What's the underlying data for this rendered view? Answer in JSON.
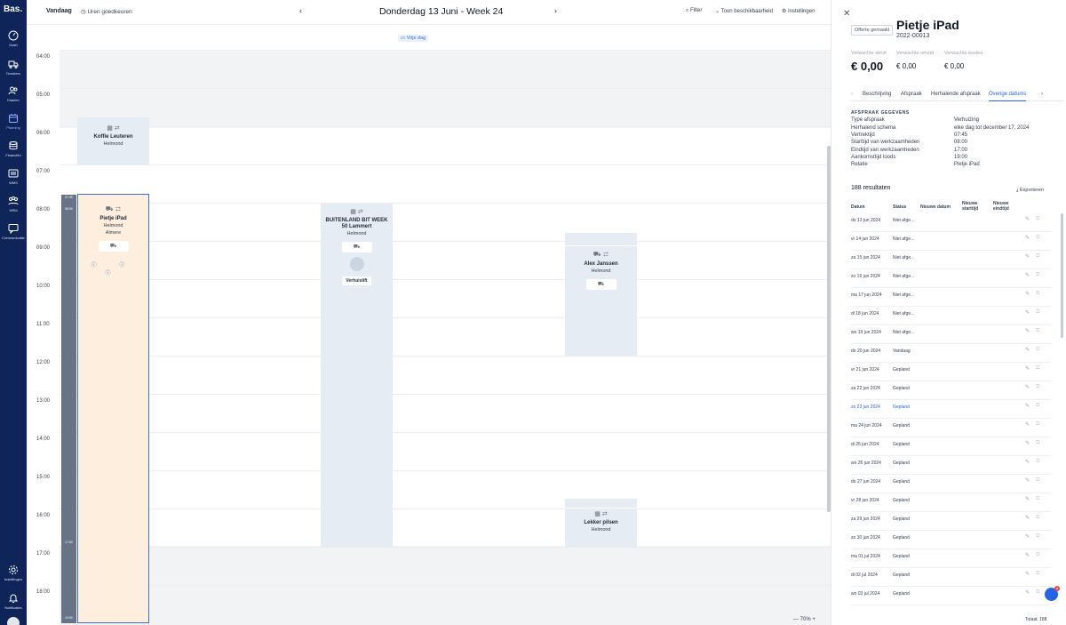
{
  "sidebar": {
    "logo": "Bas.",
    "items": [
      {
        "label": "Dash",
        "icon": "gauge-icon"
      },
      {
        "label": "Dossiers",
        "icon": "truck-icon"
      },
      {
        "label": "Klanten",
        "icon": "users-icon"
      },
      {
        "label": "Planning",
        "icon": "calendar-icon",
        "active": true
      },
      {
        "label": "Financiën",
        "icon": "coins-icon"
      },
      {
        "label": "WMS",
        "icon": "warehouse-icon"
      },
      {
        "label": "HRM",
        "icon": "people-icon"
      },
      {
        "label": "Communicatie",
        "icon": "chat-icon"
      },
      {
        "label": "Instellingen",
        "icon": "gear-icon"
      },
      {
        "label": "Notificaties",
        "icon": "bell-icon"
      }
    ]
  },
  "topbar": {
    "today": "Vandaag",
    "approve_hours": "Uren goedkeuren",
    "prev": "‹",
    "date_title": "Donderdag 13 Juni - Week 24",
    "next": "›",
    "filter": "Filter",
    "show_availability": "Toon beschikbaarheid",
    "settings": "Instellingen"
  },
  "calendar": {
    "free_day": "Vrije dag",
    "hours": [
      "04:00",
      "05:00",
      "06:00",
      "07:00",
      "08:00",
      "09:00",
      "10:00",
      "11:00",
      "12:00",
      "13:00",
      "14:00",
      "15:00",
      "16:00",
      "17:00",
      "18:00"
    ],
    "timeline_labels": {
      "start": "07:45",
      "start2": "08:00",
      "end": "17:00",
      "end2": "19:00"
    },
    "zoom": "— 70% +",
    "events": {
      "koffie": {
        "title": "Koffie Leuteren",
        "line1": "Helmond"
      },
      "pietje": {
        "title": "Pietje iPad",
        "line1": "Helmond",
        "line2": "Almere",
        "icons": "ⓘ ⓘ ⓘ"
      },
      "buitenland": {
        "title": "BUITENLAND BIT WEEK",
        "line1": "50 Lammert",
        "line2": "Helmond",
        "button": "Verhuislift"
      },
      "alex": {
        "title": "Alex Janssen",
        "line1": "Helmond"
      },
      "lekker": {
        "title": "Lekker pilsen",
        "line1": "Helmond"
      }
    }
  },
  "panel": {
    "badge": "Offerte gemaakt",
    "title": "Pietje iPad",
    "number": "2022-00013",
    "metrics": [
      {
        "label": "Verwachte winst",
        "value": "€ 0,00"
      },
      {
        "label": "Verwachte omzet",
        "value": "€ 0,00"
      },
      {
        "label": "Verwachte kosten",
        "value": "€ 0,00"
      }
    ],
    "tabs": [
      "Beschrijving",
      "Afspraak",
      "Herhalende afspraak",
      "Overige datums"
    ],
    "section_title": "AFSPRAAK GEGEVENS",
    "details": [
      {
        "k": "Type afspraak",
        "v": "Verhuizing"
      },
      {
        "k": "Herhalend schema",
        "v": "elke dag tot december 17, 2024"
      },
      {
        "k": "Vertrektijd",
        "v": "07:45"
      },
      {
        "k": "Starttijd van werkzaamheden",
        "v": "08:00"
      },
      {
        "k": "Eindtijd van werkzaamheden",
        "v": "17:00"
      },
      {
        "k": "Aankomsttijd loods",
        "v": "19:00"
      },
      {
        "k": "Relatie",
        "v": "Pietje iPad"
      }
    ],
    "results": "188 resultaten",
    "export": "Exporteren",
    "columns": [
      "Datum",
      "Status",
      "Nieuwe datum",
      "Nieuwe starttijd",
      "Nieuwe eindtijd"
    ],
    "rows": [
      {
        "date": "do 13 jun 2024",
        "status": "Niet afge..."
      },
      {
        "date": "vr 14 jun 2024",
        "status": "Niet afge..."
      },
      {
        "date": "za 15 jun 2024",
        "status": "Niet afge..."
      },
      {
        "date": "zo 16 jun 2024",
        "status": "Niet afge..."
      },
      {
        "date": "ma 17 jun 2024",
        "status": "Niet afge..."
      },
      {
        "date": "di 18 jun 2024",
        "status": "Niet afge..."
      },
      {
        "date": "wo 19 jun 2024",
        "status": "Niet afge..."
      },
      {
        "date": "do 20 jun 2024",
        "status": "Vandaag"
      },
      {
        "date": "vr 21 jun 2024",
        "status": "Gepland"
      },
      {
        "date": "za 22 jun 2024",
        "status": "Gepland"
      },
      {
        "date": "zo 23 jun 2024",
        "status": "Gepland",
        "highlight": true
      },
      {
        "date": "ma 24 jun 2024",
        "status": "Gepland"
      },
      {
        "date": "di 25 jun 2024",
        "status": "Gepland"
      },
      {
        "date": "wo 26 jun 2024",
        "status": "Gepland"
      },
      {
        "date": "do 27 jun 2024",
        "status": "Gepland"
      },
      {
        "date": "vr 28 jun 2024",
        "status": "Gepland"
      },
      {
        "date": "za 29 jun 2024",
        "status": "Gepland"
      },
      {
        "date": "zo 30 jun 2024",
        "status": "Gepland"
      },
      {
        "date": "ma 01 jul 2024",
        "status": "Gepland"
      },
      {
        "date": "di 02 jul 2024",
        "status": "Gepland"
      },
      {
        "date": "wo 03 jul 2024",
        "status": "Gepland"
      }
    ],
    "total": "Totaal: 188",
    "chat_count": "4"
  }
}
